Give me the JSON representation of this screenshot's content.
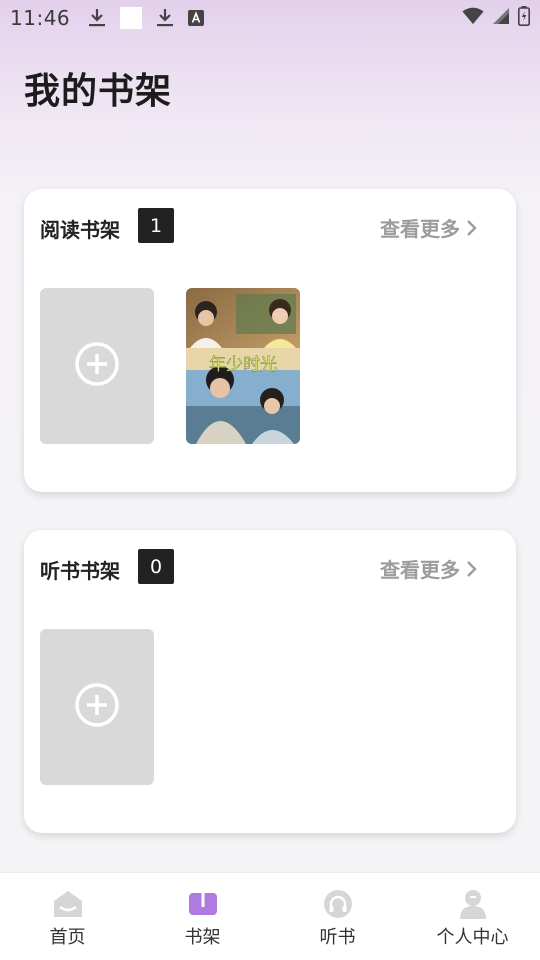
{
  "status_bar": {
    "time": "11:46",
    "left_icons": [
      "download-icon",
      "white-square-icon",
      "download-icon",
      "text-a-icon"
    ],
    "right_icons": [
      "wifi-icon",
      "cellular-signal-icon",
      "battery-charging-icon"
    ]
  },
  "page": {
    "title": "我的书架"
  },
  "reading_shelf": {
    "title": "阅读书架",
    "count": "1",
    "view_more": "查看更多",
    "add_icon": "add-circle-icon",
    "books": [
      {
        "cover_text": "年少时光"
      }
    ]
  },
  "listening_shelf": {
    "title": "听书书架",
    "count": "0",
    "view_more": "查看更多",
    "add_icon": "add-circle-icon"
  },
  "bottom_nav": {
    "items": [
      {
        "label": "首页",
        "icon": "home-icon",
        "active": false
      },
      {
        "label": "书架",
        "icon": "book-icon",
        "active": true
      },
      {
        "label": "听书",
        "icon": "headphones-icon",
        "active": false
      },
      {
        "label": "个人中心",
        "icon": "person-icon",
        "active": false
      }
    ]
  },
  "colors": {
    "accent": "#b07be0",
    "inactive_icon": "#d6d6d6",
    "placeholder_tile": "#d9d9d9",
    "badge_bg": "#222222",
    "view_more_text": "#9c9c9c"
  }
}
